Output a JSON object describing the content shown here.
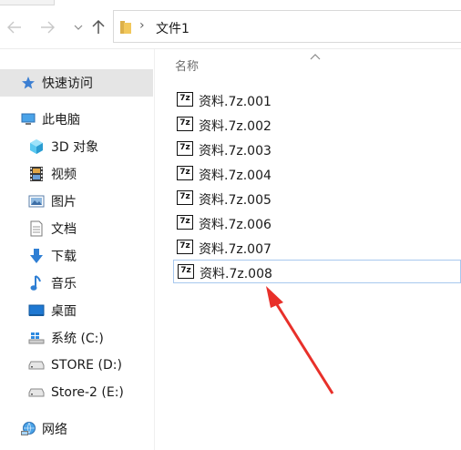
{
  "nav": {
    "back_icon": "arrow-left-icon",
    "forward_icon": "arrow-right-icon",
    "up_icon": "arrow-up-icon",
    "address_path": "文件1"
  },
  "sidebar": {
    "items": [
      {
        "label": "快速访问",
        "icon": "star-icon"
      },
      {
        "label": "此电脑",
        "icon": "computer-icon"
      },
      {
        "label": "3D 对象",
        "icon": "cube-3d-icon"
      },
      {
        "label": "视频",
        "icon": "video-icon"
      },
      {
        "label": "图片",
        "icon": "picture-icon"
      },
      {
        "label": "文档",
        "icon": "document-icon"
      },
      {
        "label": "下载",
        "icon": "download-icon"
      },
      {
        "label": "音乐",
        "icon": "music-icon"
      },
      {
        "label": "桌面",
        "icon": "desktop-icon"
      },
      {
        "label": "系统 (C:)",
        "icon": "windows-drive-icon"
      },
      {
        "label": "STORE (D:)",
        "icon": "drive-icon"
      },
      {
        "label": "Store-2 (E:)",
        "icon": "drive-icon"
      },
      {
        "label": "网络",
        "icon": "network-icon"
      }
    ]
  },
  "main": {
    "column_header": "名称",
    "files": [
      {
        "name": "资料.7z.001"
      },
      {
        "name": "资料.7z.002"
      },
      {
        "name": "资料.7z.003"
      },
      {
        "name": "资料.7z.004"
      },
      {
        "name": "资料.7z.005"
      },
      {
        "name": "资料.7z.006"
      },
      {
        "name": "资料.7z.007"
      },
      {
        "name": "资料.7z.008"
      }
    ],
    "file_icon_text": "7z"
  },
  "colors": {
    "annotation_arrow": "#e8302a",
    "selection_border": "#a8c8ee",
    "sidebar_selected": "#e5e5e5"
  }
}
